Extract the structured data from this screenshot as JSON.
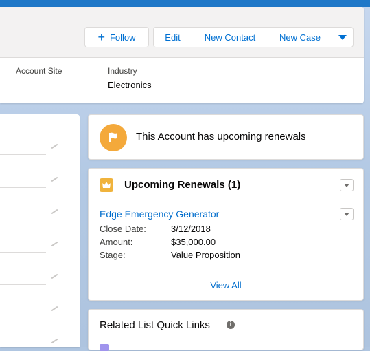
{
  "header": {
    "follow_label": "Follow",
    "actions": [
      "Edit",
      "New Contact",
      "New Case"
    ],
    "fields": [
      {
        "label": "Account Site",
        "value": ""
      },
      {
        "label": "Industry",
        "value": "Electronics"
      }
    ]
  },
  "notice": {
    "text": "This Account has upcoming renewals",
    "icon": "flag-icon",
    "color": "#f4a93b"
  },
  "renewals": {
    "title": "Upcoming Renewals (1)",
    "icon": "crown-icon",
    "record": {
      "name": "Edge Emergency Generator",
      "rows": [
        {
          "label": "Close Date:",
          "value": "3/12/2018"
        },
        {
          "label": "Amount:",
          "value": "$35,000.00"
        },
        {
          "label": "Stage:",
          "value": "Value Proposition"
        }
      ]
    },
    "view_all": "View All"
  },
  "quick_links": {
    "title": "Related List Quick Links",
    "info": "i"
  },
  "colors": {
    "brand_blue": "#0070d2",
    "link_blue": "#006dcc",
    "top_band": "#1f78c8"
  }
}
